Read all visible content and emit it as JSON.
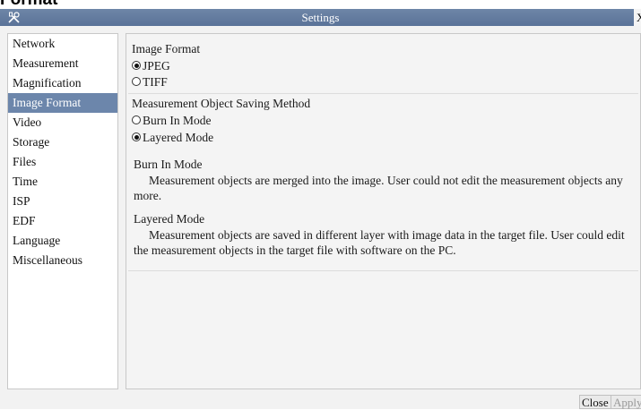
{
  "caption": "Format",
  "window": {
    "title": "Settings",
    "close_label": "X"
  },
  "sidebar": {
    "items": [
      {
        "label": "Network"
      },
      {
        "label": "Measurement"
      },
      {
        "label": "Magnification"
      },
      {
        "label": "Image Format",
        "selected": true
      },
      {
        "label": "Video"
      },
      {
        "label": "Storage"
      },
      {
        "label": "Files"
      },
      {
        "label": "Time"
      },
      {
        "label": "ISP"
      },
      {
        "label": "EDF"
      },
      {
        "label": "Language"
      },
      {
        "label": "Miscellaneous"
      }
    ]
  },
  "image_format": {
    "title": "Image Format",
    "options": [
      {
        "label": "JPEG",
        "checked": true
      },
      {
        "label": "TIFF",
        "checked": false
      }
    ]
  },
  "saving_method": {
    "title": "Measurement Object Saving Method",
    "options": [
      {
        "label": "Burn In Mode",
        "checked": false
      },
      {
        "label": "Layered Mode",
        "checked": true
      }
    ]
  },
  "descriptions": {
    "burn_in": {
      "title": "Burn In Mode",
      "body": "Measurement objects are merged into the image. User could not edit the measurement objects any more."
    },
    "layered": {
      "title": "Layered Mode",
      "body": "Measurement objects are saved in different layer with image data in the target file. User could edit the measurement objects in the target file with software on the PC."
    }
  },
  "buttons": {
    "close": "Close",
    "apply": "Apply"
  },
  "colors": {
    "titlebar": "#5a7398",
    "selected_item": "#6c86ab"
  }
}
